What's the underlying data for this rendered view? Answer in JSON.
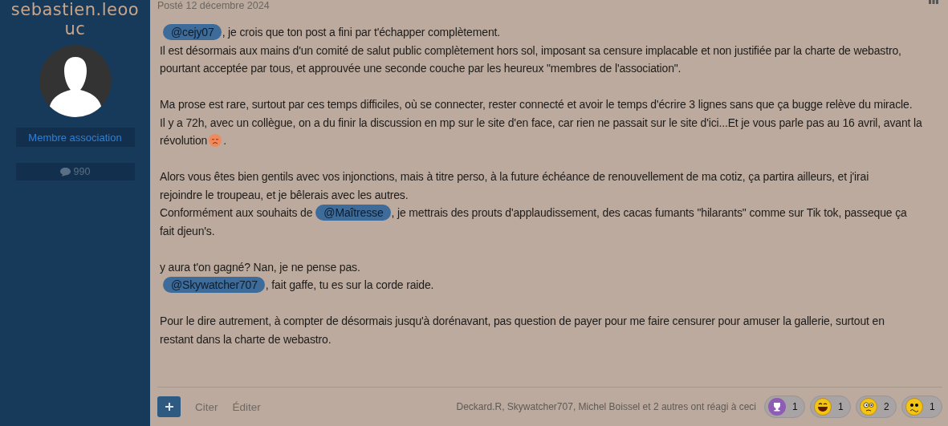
{
  "author": {
    "name": "sebastien.leoouc",
    "role": "Membre association",
    "posts": "990"
  },
  "post": {
    "date": "Posté 12 décembre 2024",
    "paragraphs": [
      [
        [
          {
            "kind": "mention",
            "text": "@cejy07"
          },
          {
            "kind": "text",
            "text": ", je crois que ton post a fini par t'échapper complètement."
          }
        ],
        [
          {
            "kind": "text",
            "text": "Il est désormais aux mains d'un comité de salut public complètement hors sol, imposant sa censure implacable et non justifiée par la charte de webastro,"
          }
        ],
        [
          {
            "kind": "text",
            "text": "pourtant acceptée par tous, et approuvée une seconde couche par les heureux \"membres de l'association\"."
          }
        ]
      ],
      [
        [
          {
            "kind": "text",
            "text": "Ma prose est rare, surtout par ces temps difficiles, où se connecter, rester connecté et avoir le temps d'écrire 3 lignes sans que ça bugge relève du miracle."
          }
        ],
        [
          {
            "kind": "text",
            "text": "Il y a 72h, avec un collègue, on a du finir la discussion en mp sur le site d'en face, car rien ne passait sur le site d'ici...Et je vous parle pas au 16 avril, avant la"
          }
        ],
        [
          {
            "kind": "text",
            "text": "révolution"
          },
          {
            "kind": "emoji"
          },
          {
            "kind": "text",
            "text": "."
          }
        ]
      ],
      [
        [
          {
            "kind": "text",
            "text": "Alors vous êtes bien gentils avec vos injonctions, mais à titre perso, à la future échéance de renouvellement de ma cotiz, ça partira ailleurs, et j'irai"
          }
        ],
        [
          {
            "kind": "text",
            "text": "rejoindre le troupeau, et je bêlerais avec les autres."
          }
        ],
        [
          {
            "kind": "text",
            "text": "Conformément aux souhaits de"
          },
          {
            "kind": "mention",
            "text": "@Maîtresse"
          },
          {
            "kind": "text",
            "text": ", je mettrais des prouts d'applaudissement, des cacas fumants \"hilarants\" comme sur Tik tok, passeque ça"
          }
        ],
        [
          {
            "kind": "text",
            "text": "fait djeun's."
          }
        ]
      ],
      [
        [
          {
            "kind": "text",
            "text": "y aura t'on gagné? Nan, je ne pense pas."
          }
        ],
        [
          {
            "kind": "mention",
            "text": "@Skywatcher707"
          },
          {
            "kind": "text",
            "text": ", fait gaffe, tu es sur la corde raide."
          }
        ]
      ],
      [
        [
          {
            "kind": "text",
            "text": "Pour le dire autrement, à compter de désormais jusqu'à dorénavant, pas question de payer pour me faire censurer pour amuser la gallerie, surtout en"
          }
        ],
        [
          {
            "kind": "text",
            "text": "restant dans la charte de webastro."
          }
        ]
      ]
    ]
  },
  "footer": {
    "actions": [
      "Citer",
      "Éditer"
    ],
    "reacted": "Deckard.R, Skywatcher707, Michel Boissel et 2 autres ont réagi à ceci",
    "reactions": [
      {
        "kind": "trophy",
        "count": "1"
      },
      {
        "kind": "laugh",
        "count": "1"
      },
      {
        "kind": "confused",
        "count": "2"
      },
      {
        "kind": "worried",
        "count": "1"
      }
    ]
  }
}
